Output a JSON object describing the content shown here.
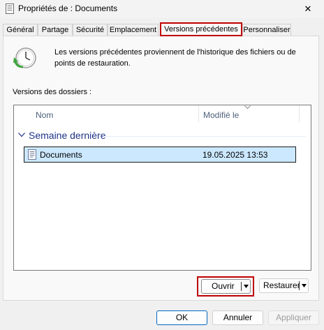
{
  "window": {
    "title": "Propriétés de : Documents",
    "close_glyph": "✕"
  },
  "tabs": [
    {
      "label": "Général",
      "active": false
    },
    {
      "label": "Partage",
      "active": false
    },
    {
      "label": "Sécurité",
      "active": false
    },
    {
      "label": "Emplacement",
      "active": false
    },
    {
      "label": "Versions précédentes",
      "active": true
    },
    {
      "label": "Personnaliser",
      "active": false
    }
  ],
  "panel": {
    "info_text": "Les versions précédentes proviennent de l'historique des fichiers ou de points de restauration.",
    "versions_label": "Versions des dossiers :",
    "columns": {
      "name": "Nom",
      "modified": "Modifié le"
    },
    "group_title": "Semaine dernière",
    "rows": [
      {
        "name": "Documents",
        "modified": "19.05.2025 13:53",
        "selected": true
      }
    ]
  },
  "buttons": {
    "open": "Ouvrir",
    "restore": "Restaurer",
    "ok": "OK",
    "cancel": "Annuler",
    "apply": "Appliquer"
  },
  "colors": {
    "highlight_border": "#c00000",
    "selection": "#cce8ff",
    "group_title": "#1e3287",
    "header_text": "#4c607a"
  },
  "icons": {
    "window": "folder-properties-icon",
    "clock": "clock-restore-icon",
    "row": "document-icon"
  }
}
